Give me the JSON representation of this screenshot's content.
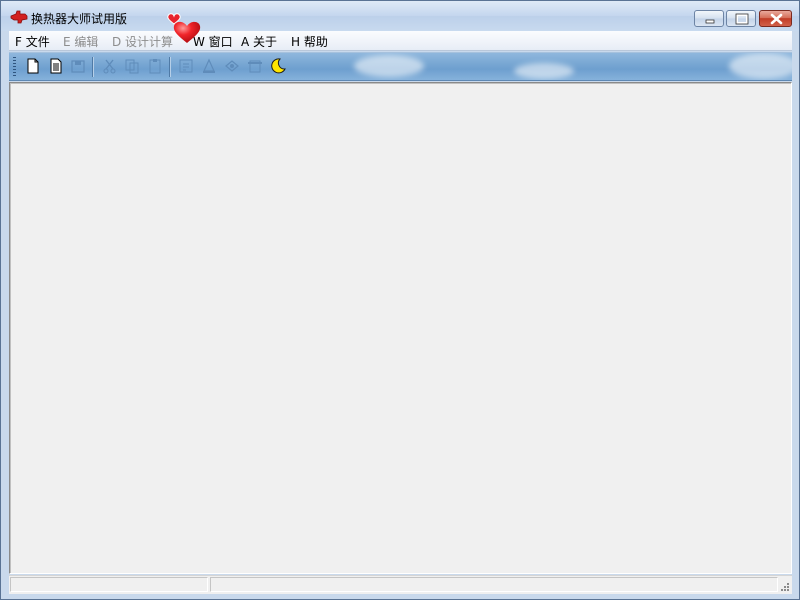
{
  "window": {
    "title": "换热器大师试用版",
    "controls": {
      "minimize_icon": "minimize-icon",
      "maximize_icon": "maximize-icon",
      "close_icon": "close-icon"
    }
  },
  "menu": [
    {
      "label": "F 文件",
      "enabled": true
    },
    {
      "label": "E 编辑",
      "enabled": false
    },
    {
      "label": "D 设计计算",
      "enabled": false
    },
    {
      "label": "W 窗口",
      "enabled": true
    },
    {
      "label": "A 关于",
      "enabled": true
    },
    {
      "label": "H 帮助",
      "enabled": true
    }
  ],
  "toolbar": {
    "buttons": [
      {
        "icon": "new-file-icon",
        "enabled": true
      },
      {
        "icon": "open-file-icon",
        "enabled": true
      },
      {
        "icon": "save-icon",
        "enabled": false
      },
      {
        "icon": "cut-icon",
        "enabled": false
      },
      {
        "icon": "copy-icon",
        "enabled": false
      },
      {
        "icon": "paste-icon",
        "enabled": false
      },
      {
        "icon": "calculate-icon",
        "enabled": false
      },
      {
        "icon": "print-icon",
        "enabled": false
      },
      {
        "icon": "preview-icon",
        "enabled": false
      },
      {
        "icon": "report-icon",
        "enabled": false
      },
      {
        "icon": "moon-icon",
        "enabled": true
      }
    ]
  },
  "colors": {
    "title_bg": "#c4d6ee",
    "toolbar_bg": "#78a7d3",
    "client_bg": "#f0f0f0",
    "disabled_text": "#8d8d8d",
    "close_button": "#c13c26"
  },
  "statusbar": {
    "panes": [
      "",
      ""
    ]
  }
}
